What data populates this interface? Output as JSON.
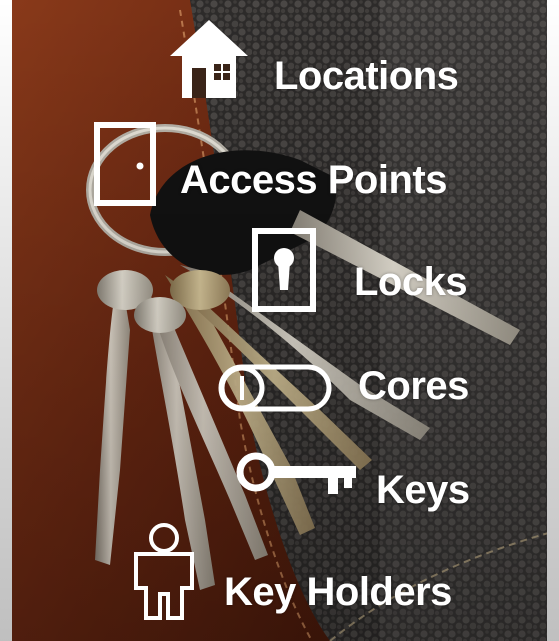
{
  "menu": {
    "items": [
      {
        "label": "Locations",
        "icon": "house-icon"
      },
      {
        "label": "Access Points",
        "icon": "door-icon"
      },
      {
        "label": "Locks",
        "icon": "lock-icon"
      },
      {
        "label": "Cores",
        "icon": "core-icon"
      },
      {
        "label": "Keys",
        "icon": "key-icon"
      },
      {
        "label": "Key Holders",
        "icon": "person-icon"
      }
    ]
  },
  "colors": {
    "label": "#ffffff",
    "icon": "#ffffff",
    "leather": "#6e2a12",
    "wallet": "#2e2c2b"
  }
}
